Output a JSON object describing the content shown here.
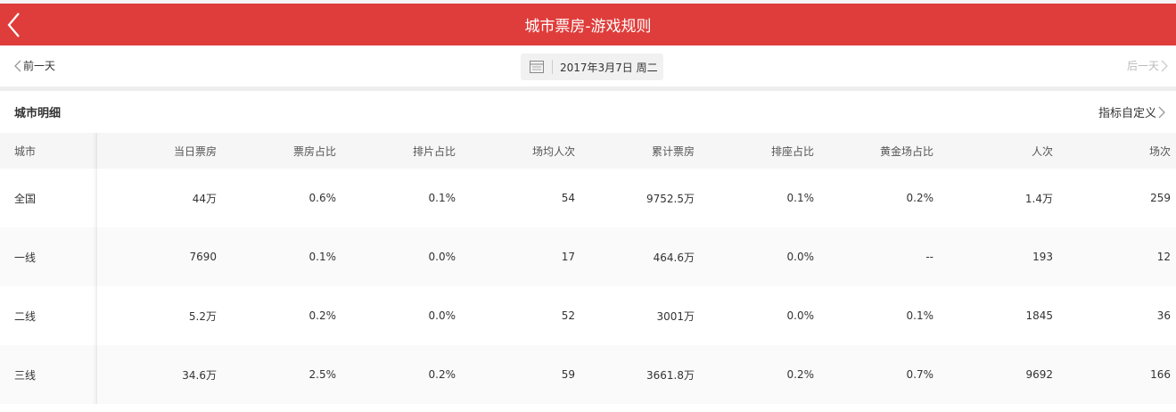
{
  "header": {
    "title": "城市票房-游戏规则"
  },
  "nav": {
    "prev_label": "前一天",
    "next_label": "后一天",
    "date": "2017年3月7日 周二"
  },
  "section": {
    "title": "城市明细",
    "customize_label": "指标自定义"
  },
  "table": {
    "columns": [
      "城市",
      "当日票房",
      "票房占比",
      "排片占比",
      "场均人次",
      "累计票房",
      "排座占比",
      "黄金场占比",
      "人次",
      "场次"
    ],
    "rows": [
      [
        "全国",
        "44万",
        "0.6%",
        "0.1%",
        "54",
        "9752.5万",
        "0.1%",
        "0.2%",
        "1.4万",
        "259"
      ],
      [
        "一线",
        "7690",
        "0.1%",
        "0.0%",
        "17",
        "464.6万",
        "0.0%",
        "--",
        "193",
        "12"
      ],
      [
        "二线",
        "5.2万",
        "0.2%",
        "0.0%",
        "52",
        "3001万",
        "0.0%",
        "0.1%",
        "1845",
        "36"
      ],
      [
        "三线",
        "34.6万",
        "2.5%",
        "0.2%",
        "59",
        "3661.8万",
        "0.2%",
        "0.7%",
        "9692",
        "166"
      ]
    ]
  },
  "colors": {
    "header_bg": "#df3d3b",
    "text": "#333333",
    "disabled": "#bbbbbb"
  }
}
